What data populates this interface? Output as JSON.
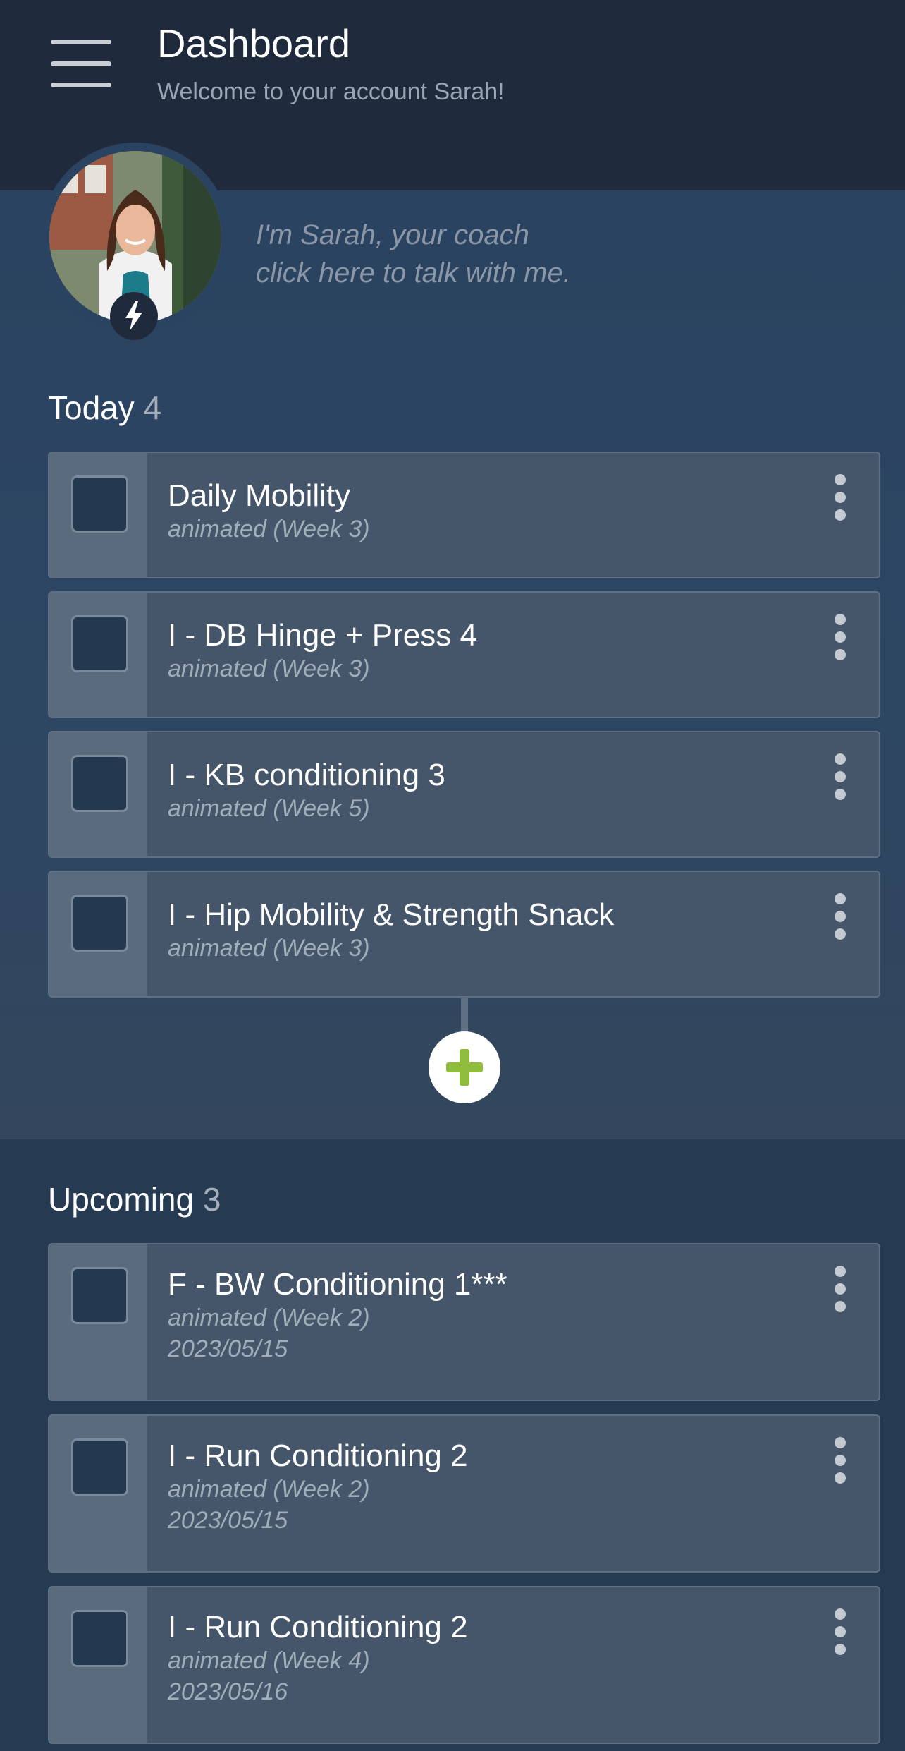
{
  "header": {
    "title": "Dashboard",
    "subtitle": "Welcome to your account Sarah!"
  },
  "coach": {
    "message_line1": "I'm Sarah, your coach",
    "message_line2": "click here to talk with me."
  },
  "today": {
    "heading": "Today",
    "count": "4",
    "items": [
      {
        "title": "Daily Mobility",
        "subtitle": "animated (Week 3)"
      },
      {
        "title": "I - DB Hinge + Press 4",
        "subtitle": "animated (Week 3)"
      },
      {
        "title": "I - KB conditioning 3",
        "subtitle": "animated (Week 5)"
      },
      {
        "title": "I - Hip Mobility & Strength Snack",
        "subtitle": "animated (Week 3)"
      }
    ]
  },
  "upcoming": {
    "heading": "Upcoming",
    "count": "3",
    "items": [
      {
        "title": "F - BW Conditioning 1***",
        "subtitle": "animated (Week 2)",
        "date": "2023/05/15"
      },
      {
        "title": "I - Run Conditioning 2",
        "subtitle": "animated (Week 2)",
        "date": "2023/05/15"
      },
      {
        "title": "I - Run Conditioning 2",
        "subtitle": "animated (Week 4)",
        "date": "2023/05/16"
      }
    ]
  },
  "icons": {
    "menu": "hamburger-menu-icon",
    "coach_badge": "lightning-bolt-icon",
    "add": "plus-icon",
    "card_menu": "more-vertical-icon"
  },
  "colors": {
    "header_bg": "#1f2b3d",
    "page_bg": "#263a52",
    "card_bg": "#45566b",
    "checkbox_bg": "#243950",
    "add_accent": "#8fbc3a"
  }
}
